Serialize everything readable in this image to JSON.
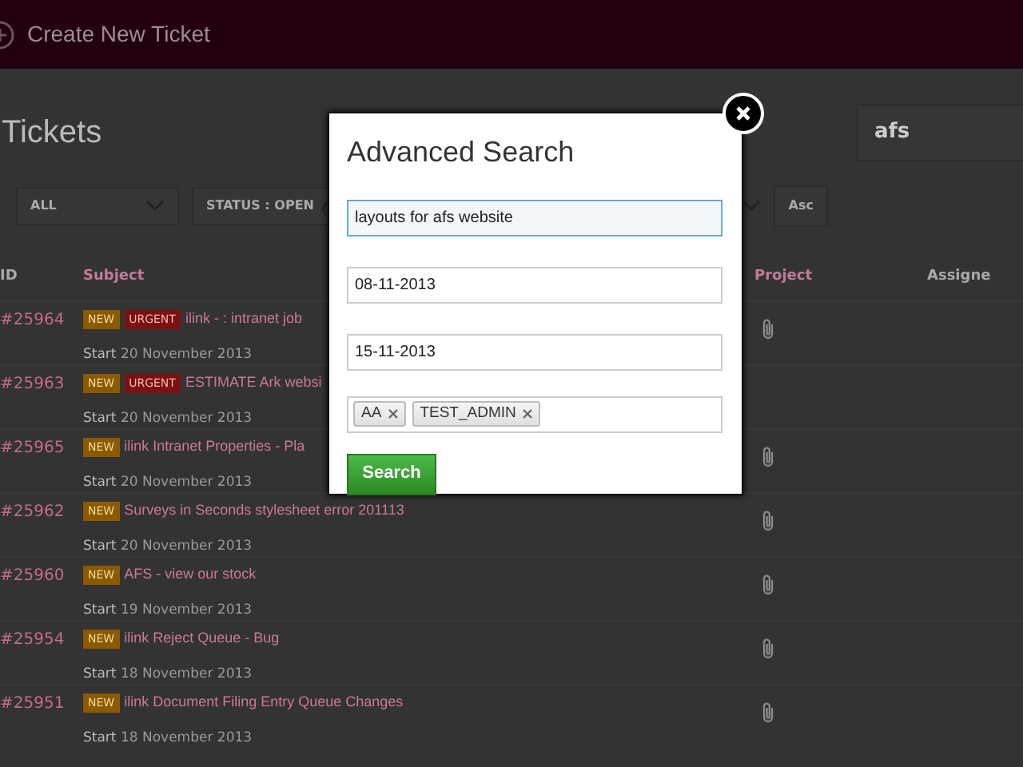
{
  "header": {
    "action": "Create New Ticket"
  },
  "page_title": "Tickets",
  "search": {
    "value": "afs"
  },
  "filters": [
    {
      "kind": "dropdown",
      "label": "ALL"
    },
    {
      "kind": "status",
      "label": "STATUS : OPEN"
    }
  ],
  "sort_button": "Asc",
  "table": {
    "columns": [
      "ID",
      "Subject",
      "Project",
      "Assigne"
    ],
    "rows": [
      {
        "id": "#25964",
        "tags": [
          {
            "kind": "new",
            "label": "NEW"
          },
          {
            "kind": "urgent",
            "label": "URGENT"
          }
        ],
        "subject": "ilink - : intranet job",
        "start_label": "Start",
        "start_date": "20 November 2013",
        "attachment": true
      },
      {
        "id": "#25963",
        "tags": [
          {
            "kind": "new",
            "label": "NEW"
          },
          {
            "kind": "urgent",
            "label": "URGENT"
          }
        ],
        "subject": "ESTIMATE Ark websi",
        "start_label": "Start",
        "start_date": "20 November 2013",
        "attachment": false
      },
      {
        "id": "#25965",
        "tags": [
          {
            "kind": "new",
            "label": "NEW"
          }
        ],
        "subject": "ilink Intranet Properties - Pla",
        "start_label": "Start",
        "start_date": "20 November 2013",
        "attachment": true
      },
      {
        "id": "#25962",
        "tags": [
          {
            "kind": "new",
            "label": "NEW"
          }
        ],
        "subject": "Surveys in Seconds stylesheet error 201113",
        "start_label": "Start",
        "start_date": "20 November 2013",
        "attachment": true
      },
      {
        "id": "#25960",
        "tags": [
          {
            "kind": "new",
            "label": "NEW"
          }
        ],
        "subject": "AFS - view our stock",
        "start_label": "Start",
        "start_date": "19 November 2013",
        "attachment": true
      },
      {
        "id": "#25954",
        "tags": [
          {
            "kind": "new",
            "label": "NEW"
          }
        ],
        "subject": "ilink Reject Queue - Bug",
        "start_label": "Start",
        "start_date": "18 November 2013",
        "attachment": true
      },
      {
        "id": "#25951",
        "tags": [
          {
            "kind": "new",
            "label": "NEW"
          }
        ],
        "subject": "ilink Document Filing Entry Queue Changes",
        "start_label": "Start",
        "start_date": "18 November 2013",
        "attachment": true
      }
    ]
  },
  "modal": {
    "title": "Advanced Search",
    "fields": [
      {
        "kind": "text",
        "value": "layouts for afs website",
        "focused": true
      },
      {
        "kind": "text",
        "value": "08-11-2013",
        "focused": false
      },
      {
        "kind": "text",
        "value": "15-11-2013",
        "focused": false
      },
      {
        "kind": "tags",
        "tags": [
          "AA",
          "TEST_ADMIN"
        ],
        "focused": false
      }
    ],
    "search_button": "Search"
  }
}
